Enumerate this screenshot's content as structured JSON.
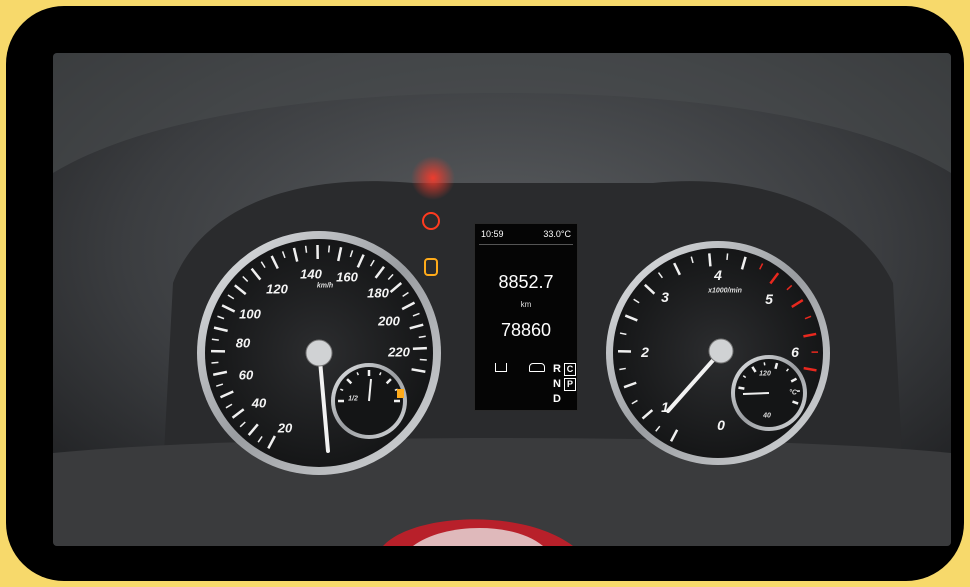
{
  "display": {
    "clock": "10:59",
    "temperature": "33.0°C",
    "trip_value": "8852.7",
    "trip_unit": "km",
    "odometer": "78860",
    "gear_r": "R",
    "gear_c": "C",
    "gear_n": "N",
    "gear_p": "P",
    "gear_d": "D"
  },
  "speedometer": {
    "labels": [
      "20",
      "40",
      "60",
      "80",
      "100",
      "120",
      "140",
      "160",
      "180",
      "200",
      "220"
    ],
    "unit": "km/h"
  },
  "fuel_gauge": {
    "label": "1/2"
  },
  "tachometer": {
    "labels": [
      "0",
      "1",
      "2",
      "3",
      "4",
      "5",
      "6"
    ],
    "unit": "x1000/min"
  },
  "temp_gauge": {
    "labels": [
      "120",
      "40"
    ],
    "unit": "°C"
  },
  "warning_lights": {
    "parking_brake": "P",
    "parking_brake_color": "#ff3b1f",
    "door_open_color": "#ffab1a"
  },
  "colors": {
    "border": "#f7d96b",
    "bezel": "#b9bcc0",
    "redline": "#e8281e"
  }
}
